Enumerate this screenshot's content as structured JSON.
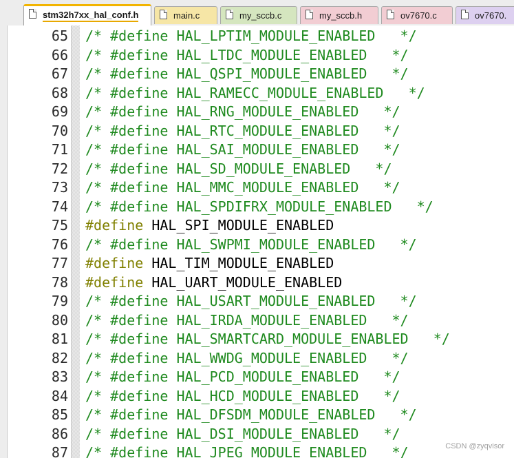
{
  "tabs": [
    {
      "label": "stm32h7xx_hal_conf.h",
      "active": true,
      "color": "#ffffff",
      "icon": "header-file-icon"
    },
    {
      "label": "main.c",
      "active": false,
      "color": "#f6e6a6",
      "icon": "c-file-icon"
    },
    {
      "label": "my_sccb.c",
      "active": false,
      "color": "#d5e6bf",
      "icon": "c-file-icon"
    },
    {
      "label": "my_sccb.h",
      "active": false,
      "color": "#f2cdd3",
      "icon": "header-file-icon"
    },
    {
      "label": "ov7670.c",
      "active": false,
      "color": "#f2cdd3",
      "icon": "c-file-icon"
    },
    {
      "label": "ov7670.",
      "active": false,
      "color": "#ddd0f0",
      "icon": "c-file-icon"
    }
  ],
  "colors": {
    "comment": "#1f8a1f",
    "keyword": "#808000",
    "macro": "#000000",
    "active_tab_accent": "#f2b400"
  },
  "lines": [
    {
      "num": "65",
      "kind": "comment",
      "text": "/* #define HAL_LPTIM_MODULE_ENABLED   */"
    },
    {
      "num": "66",
      "kind": "comment",
      "text": "/* #define HAL_LTDC_MODULE_ENABLED   */"
    },
    {
      "num": "67",
      "kind": "comment",
      "text": "/* #define HAL_QSPI_MODULE_ENABLED   */"
    },
    {
      "num": "68",
      "kind": "comment",
      "text": "/* #define HAL_RAMECC_MODULE_ENABLED   */"
    },
    {
      "num": "69",
      "kind": "comment",
      "text": "/* #define HAL_RNG_MODULE_ENABLED   */"
    },
    {
      "num": "70",
      "kind": "comment",
      "text": "/* #define HAL_RTC_MODULE_ENABLED   */"
    },
    {
      "num": "71",
      "kind": "comment",
      "text": "/* #define HAL_SAI_MODULE_ENABLED   */"
    },
    {
      "num": "72",
      "kind": "comment",
      "text": "/* #define HAL_SD_MODULE_ENABLED   */"
    },
    {
      "num": "73",
      "kind": "comment",
      "text": "/* #define HAL_MMC_MODULE_ENABLED   */"
    },
    {
      "num": "74",
      "kind": "comment",
      "text": "/* #define HAL_SPDIFRX_MODULE_ENABLED   */"
    },
    {
      "num": "75",
      "kind": "define",
      "keyword": "#define",
      "macro": "HAL_SPI_MODULE_ENABLED"
    },
    {
      "num": "76",
      "kind": "comment",
      "text": "/* #define HAL_SWPMI_MODULE_ENABLED   */"
    },
    {
      "num": "77",
      "kind": "define",
      "keyword": "#define",
      "macro": "HAL_TIM_MODULE_ENABLED"
    },
    {
      "num": "78",
      "kind": "define",
      "keyword": "#define",
      "macro": "HAL_UART_MODULE_ENABLED"
    },
    {
      "num": "79",
      "kind": "comment",
      "text": "/* #define HAL_USART_MODULE_ENABLED   */"
    },
    {
      "num": "80",
      "kind": "comment",
      "text": "/* #define HAL_IRDA_MODULE_ENABLED   */"
    },
    {
      "num": "81",
      "kind": "comment",
      "text": "/* #define HAL_SMARTCARD_MODULE_ENABLED   */"
    },
    {
      "num": "82",
      "kind": "comment",
      "text": "/* #define HAL_WWDG_MODULE_ENABLED   */"
    },
    {
      "num": "83",
      "kind": "comment",
      "text": "/* #define HAL_PCD_MODULE_ENABLED   */"
    },
    {
      "num": "84",
      "kind": "comment",
      "text": "/* #define HAL_HCD_MODULE_ENABLED   */"
    },
    {
      "num": "85",
      "kind": "comment",
      "text": "/* #define HAL_DFSDM_MODULE_ENABLED   */"
    },
    {
      "num": "86",
      "kind": "comment",
      "text": "/* #define HAL_DSI_MODULE_ENABLED   */"
    },
    {
      "num": "87",
      "kind": "comment",
      "text": "/* #define HAL_JPEG_MODULE_ENABLED   */"
    }
  ],
  "watermark": "CSDN @zyqvisor"
}
